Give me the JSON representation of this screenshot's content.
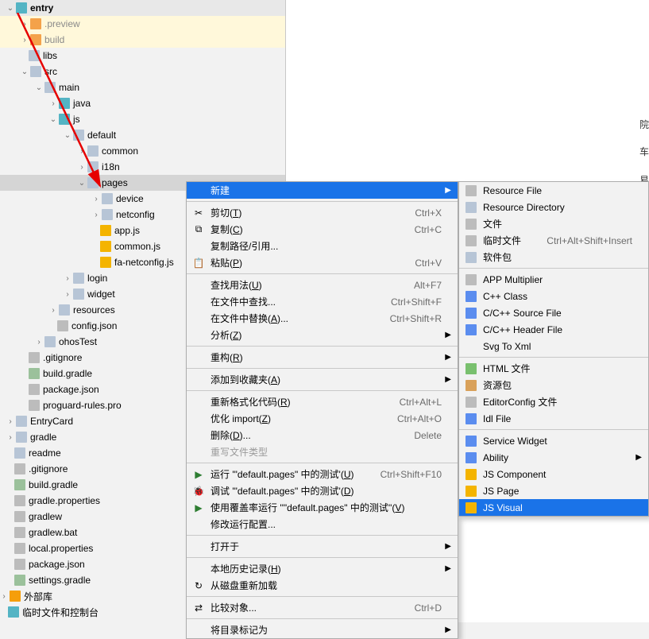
{
  "tree": {
    "entry": "entry",
    "preview": ".preview",
    "build": "build",
    "libs": "libs",
    "src": "src",
    "main": "main",
    "java": "java",
    "js": "js",
    "default": "default",
    "common": "common",
    "i18n": "i18n",
    "pages": "pages",
    "device": "device",
    "netconfig": "netconfig",
    "appjs": "app.js",
    "commonjs": "common.js",
    "fanetconfig": "fa-netconfig.js",
    "login": "login",
    "widget": "widget",
    "resources": "resources",
    "configjson": "config.json",
    "ohosTest": "ohosTest",
    "gitignore": ".gitignore",
    "buildgradle": "build.gradle",
    "packagejson": "package.json",
    "proguard": "proguard-rules.pro",
    "entrycard": "EntryCard",
    "gradle": "gradle",
    "readme": "readme",
    "gitignore2": ".gitignore",
    "buildgradle2": "build.gradle",
    "gradleprops": "gradle.properties",
    "gradlew": "gradlew",
    "gradlewbat": "gradlew.bat",
    "localprops": "local.properties",
    "packagejson2": "package.json",
    "settingsgradle": "settings.gradle",
    "extlibs": "外部库",
    "scratches": "临时文件和控制台"
  },
  "menu1": {
    "new": "新建",
    "cut": "剪切(T)",
    "copy": "复制(C)",
    "copypath": "复制路径/引用...",
    "paste": "粘贴(P)",
    "findusages": "查找用法(U)",
    "findinfiles": "在文件中查找...",
    "replaceinfiles": "在文件中替换(A)...",
    "analyze": "分析(Z)",
    "refactor": "重构(R)",
    "addfav": "添加到收藏夹(A)",
    "reformat": "重新格式化代码(R)",
    "optimports": "优化 import(Z)",
    "delete": "删除(D)...",
    "overridetype": "重写文件类型",
    "runtest": "运行 '\"default.pages\" 中的测试'(U)",
    "debugtest": "调试 '\"default.pages\" 中的测试'(D)",
    "coverage": "使用覆盖率运行 ''\"default.pages\" 中的测试''(V)",
    "editruncfg": "修改运行配置...",
    "openin": "打开于",
    "localhist": "本地历史记录(H)",
    "reloaddisk": "从磁盘重新加载",
    "compare": "比较对象...",
    "markdir": "将目录标记为",
    "sc_cut": "Ctrl+X",
    "sc_copy": "Ctrl+C",
    "sc_paste": "Ctrl+V",
    "sc_find": "Alt+F7",
    "sc_findin": "Ctrl+Shift+F",
    "sc_replin": "Ctrl+Shift+R",
    "sc_reformat": "Ctrl+Alt+L",
    "sc_optimp": "Ctrl+Alt+O",
    "sc_delete": "Delete",
    "sc_run": "Ctrl+Shift+F10",
    "sc_compare": "Ctrl+D"
  },
  "menu2": {
    "resfile": "Resource File",
    "resdir": "Resource Directory",
    "file": "文件",
    "scratch": "临时文件",
    "sc_scratch": "Ctrl+Alt+Shift+Insert",
    "pkg": "软件包",
    "appmult": "APP Multiplier",
    "cppclass": "C++ Class",
    "cppsrc": "C/C++ Source File",
    "cpphdr": "C/C++ Header File",
    "svgxml": "Svg To Xml",
    "htmlfile": "HTML 文件",
    "resbundle": "资源包",
    "editorcfg": "EditorConfig 文件",
    "idlfile": "Idl File",
    "svcwidget": "Service Widget",
    "ability": "Ability",
    "jscomp": "JS Component",
    "jspage": "JS Page",
    "jsvisual": "JS Visual"
  },
  "editor": {
    "t1": "院",
    "t2": "车",
    "t3": "易"
  }
}
